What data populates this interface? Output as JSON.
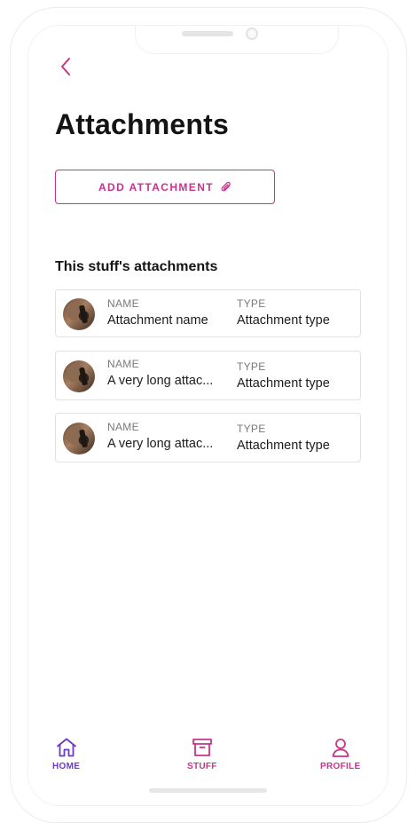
{
  "header": {
    "back_icon": "chevron-left-icon",
    "title": "Attachments"
  },
  "add_button": {
    "label": "ADD ATTACHMENT",
    "icon": "paperclip-icon"
  },
  "section": {
    "title": "This stuff's attachments"
  },
  "attachments": [
    {
      "name_label": "NAME",
      "name": "Attachment name",
      "type_label": "TYPE",
      "type": "Attachment type"
    },
    {
      "name_label": "NAME",
      "name": "A very long attac...",
      "type_label": "TYPE",
      "type": "Attachment type"
    },
    {
      "name_label": "NAME",
      "name": "A very long attac...",
      "type_label": "TYPE",
      "type": "Attachment type"
    }
  ],
  "nav": {
    "home": {
      "label": "HOME",
      "icon": "home-icon",
      "color": "#6a3bc8"
    },
    "stuff": {
      "label": "STUFF",
      "icon": "archive-box-icon",
      "color": "#c8338d"
    },
    "profile": {
      "label": "PROFILE",
      "icon": "user-icon",
      "color": "#c8338d"
    }
  },
  "colors": {
    "accent": "#c8338d",
    "home_accent": "#6a3bc8",
    "text": "#141414",
    "muted": "#7a7a7a",
    "border": "#e2e2e2"
  }
}
